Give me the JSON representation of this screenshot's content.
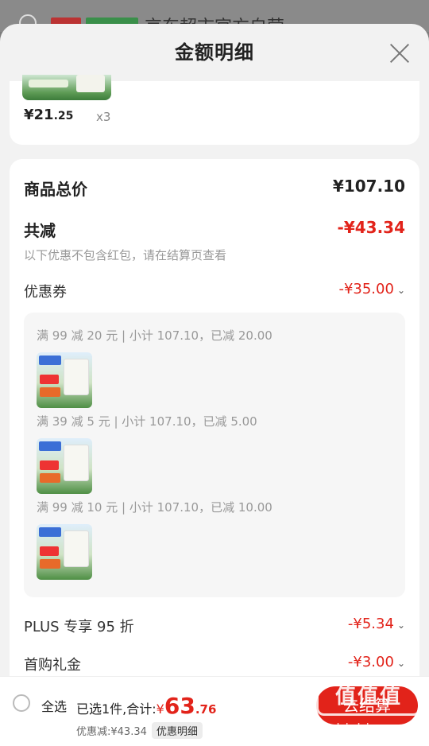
{
  "background": {
    "title_partial": "京东超市官方自营"
  },
  "sheet": {
    "title": "金额明细"
  },
  "product": {
    "price_int": "¥21",
    "price_frac": ".25",
    "quantity": "x3"
  },
  "totals": {
    "goods_total_label": "商品总价",
    "goods_total_value": "¥107.10",
    "reduced_label": "共减",
    "reduced_value": "-¥43.34",
    "reduced_note": "以下优惠不包含红包，请在结算页查看"
  },
  "coupon": {
    "label": "优惠券",
    "value": "-¥35.00",
    "items": [
      {
        "text": "满 99 减 20 元 | 小计 107.10，已减 20.00"
      },
      {
        "text": "满 39 减 5 元 | 小计 107.10，已减 5.00"
      },
      {
        "text": "满 99 减 10 元 | 小计 107.10，已减 10.00"
      }
    ]
  },
  "plus": {
    "label": "PLUS 专享 95 折",
    "value": "-¥5.34"
  },
  "first_buy": {
    "label": "首购礼金",
    "value": "-¥3.00"
  },
  "bottom": {
    "select_all": "全选",
    "selected_prefix": "已选1件,合计:",
    "total_yen": "¥",
    "total_int": "63",
    "total_frac": ".76",
    "discount_text": "优惠减:¥43.34",
    "detail_btn": "优惠明细",
    "checkout": "去结算"
  },
  "watermark": {
    "logo": "值值值",
    "site": "zhizhizhi.com"
  },
  "colors": {
    "accent_red": "#e2231a"
  }
}
